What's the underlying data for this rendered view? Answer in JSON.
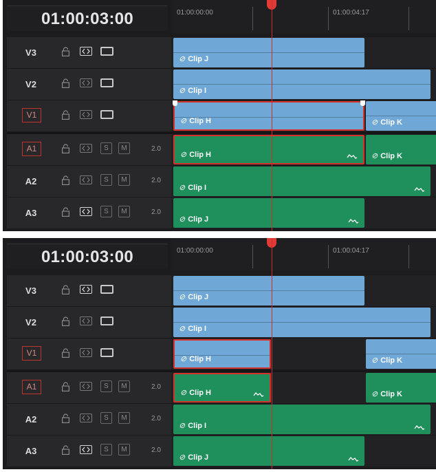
{
  "panels": [
    {
      "timecode": "01:00:03:00",
      "ruler": [
        "01:00:00:00",
        "01:00:04:17"
      ],
      "tracks": [
        {
          "name": "V3",
          "type": "video",
          "armed": false,
          "autoselect": true
        },
        {
          "name": "V2",
          "type": "video",
          "armed": false,
          "autoselect": false
        },
        {
          "name": "V1",
          "type": "video",
          "armed": true,
          "autoselect": false
        },
        {
          "name": "A1",
          "type": "audio",
          "armed": true,
          "autoselect": false,
          "channels": "2.0"
        },
        {
          "name": "A2",
          "type": "audio",
          "armed": false,
          "autoselect": false,
          "channels": "2.0"
        },
        {
          "name": "A3",
          "type": "audio",
          "armed": false,
          "autoselect": true,
          "channels": "2.0"
        }
      ],
      "clips": {
        "v3": [
          "Clip J"
        ],
        "v2": [
          "Clip I"
        ],
        "v1": [
          "Clip H",
          "Clip K"
        ],
        "a1": [
          "Clip H",
          "Clip K"
        ],
        "a2": [
          "Clip I"
        ],
        "a3": [
          "Clip J"
        ]
      }
    },
    {
      "timecode": "01:00:03:00",
      "ruler": [
        "01:00:00:00",
        "01:00:04:17"
      ],
      "tracks": [
        {
          "name": "V3",
          "type": "video",
          "armed": false,
          "autoselect": true
        },
        {
          "name": "V2",
          "type": "video",
          "armed": false,
          "autoselect": false
        },
        {
          "name": "V1",
          "type": "video",
          "armed": true,
          "autoselect": false
        },
        {
          "name": "A1",
          "type": "audio",
          "armed": true,
          "autoselect": false,
          "channels": "2.0"
        },
        {
          "name": "A2",
          "type": "audio",
          "armed": false,
          "autoselect": false,
          "channels": "2.0"
        },
        {
          "name": "A3",
          "type": "audio",
          "armed": false,
          "autoselect": true,
          "channels": "2.0"
        }
      ],
      "clips": {
        "v3": [
          "Clip J"
        ],
        "v2": [
          "Clip I"
        ],
        "v1": [
          "Clip H",
          "Clip K"
        ],
        "a1": [
          "Clip H",
          "Clip K"
        ],
        "a2": [
          "Clip I"
        ],
        "a3": [
          "Clip J"
        ]
      }
    }
  ],
  "buttons": {
    "solo": "S",
    "mute": "M"
  },
  "icons": {
    "lock": "lock-icon",
    "autoselect": "auto-select-icon",
    "video": "video-display-icon",
    "link": "link-icon",
    "audio": "waveform-icon"
  },
  "colors": {
    "video_clip": "#6fa8d6",
    "audio_clip": "#1f8f5c",
    "selection": "#d6322c",
    "playhead": "#e23a34"
  }
}
